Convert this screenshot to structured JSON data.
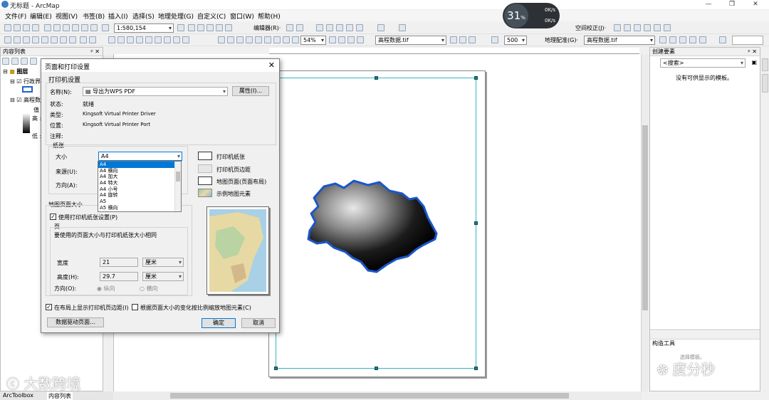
{
  "window": {
    "title": "无标题 - ArcMap"
  },
  "menus": [
    "文件(F)",
    "编辑(E)",
    "视图(V)",
    "书签(B)",
    "插入(I)",
    "选择(S)",
    "地理处理(G)",
    "自定义(C)",
    "窗口(W)",
    "帮助(H)"
  ],
  "toolbar": {
    "scale": "1:580,154",
    "editor_label": "编辑器(R)·",
    "spatial_adjust": "空间校正(J)·",
    "zoom": "54%",
    "raster_layer": "高程数据.tif",
    "zoom_val": "500",
    "georef": "地理配准(G)·",
    "georef_layer": "高程数据.tif"
  },
  "net_widget": {
    "percent": "31",
    "pct_sign": "%",
    "up": "0K/s",
    "down": "0K/s"
  },
  "toc": {
    "title": "内容列表",
    "layers_root": "图层",
    "layer1": "行政界",
    "layer2": "高程数",
    "value_label": "值",
    "high": "高 :",
    "low": "低 :"
  },
  "right_pane": {
    "title": "创建要素",
    "search_placeholder": "<搜索>",
    "empty_msg": "没有可供显示的模板。",
    "tools_title": "构造工具"
  },
  "bottom_tabs": [
    "ArcToolbox",
    "内容列表"
  ],
  "watermarks": {
    "left": "大数跨境",
    "right": "度分秒",
    "small": "选择模板。"
  },
  "dialog": {
    "title": "页面和打印设置",
    "printer_group": "打印机设置",
    "name_label": "名称(N):",
    "printer_name": "导出为WPS PDF",
    "properties_btn": "属性(I)...",
    "status_label": "状态:",
    "status_val": "就绪",
    "type_label": "类型:",
    "type_val": "Kingsoft Virtual Printer Driver",
    "where_label": "位置:",
    "where_val": "Kingsoft Virtual Printer Port",
    "comment_label": "注释:",
    "paper_group": "纸张",
    "size_label": "大小",
    "size_val": "A4",
    "source_label": "来源(U):",
    "orient_label": "方向(A):",
    "size_options": [
      "A4",
      "A4 横向",
      "A4 加大",
      "A4 特大",
      "A4 小号",
      "A4 旋转",
      "A5",
      "A5 横向"
    ],
    "legend": {
      "printer_paper": "打印机纸张",
      "printer_margins": "打印机页边距",
      "map_page": "地图页面(页面布局)",
      "sample_elements": "示例地图元素"
    },
    "map_page_group": "地图页面大小",
    "use_printer_paper": "使用打印机纸张设置(P)",
    "page_group": "页",
    "page_desc": "要使用的页面大小与打印机纸张大小相同",
    "width_label": "宽度",
    "width_val": "21",
    "width_unit": "厘米",
    "height_label": "高度(H):",
    "height_val": "29.7",
    "height_unit": "厘米",
    "orient2_label": "方向(O):",
    "portrait": "纵向",
    "landscape": "横向",
    "show_margins": "在布局上显示打印机页边距(I)",
    "scale_elements": "根据页面大小的变化按比例缩放地图元素(C)",
    "ddp_btn": "数据驱动页面...",
    "ok_btn": "确定",
    "cancel_btn": "取消"
  }
}
